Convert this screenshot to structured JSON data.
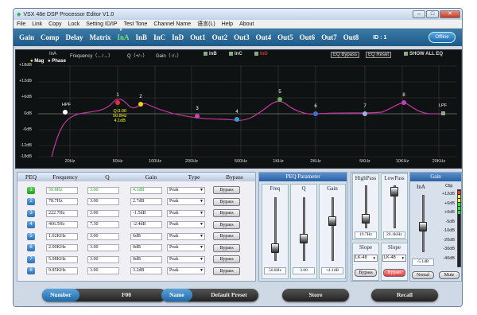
{
  "window": {
    "title": "VSX 48e DSP Processor Editor V1.0",
    "controls": [
      "–",
      "□",
      "✕"
    ]
  },
  "menu": [
    "File",
    "Link",
    "Copy",
    "Lock",
    "Setting ID/IP",
    "Test Tone",
    "Channel Name",
    "语言(L)",
    "Help",
    "About"
  ],
  "tabs": [
    "Gain",
    "Comp",
    "Delay",
    "Matrix",
    "InA",
    "InB",
    "InC",
    "InD",
    "Out1",
    "Out2",
    "Out3",
    "Out4",
    "Out5",
    "Out6",
    "Out7",
    "Out8"
  ],
  "active_tab": "InA",
  "device_id": "ID : 1",
  "offline_label": "Offline",
  "graph": {
    "channel": "InA",
    "freq_hint": "Frequency（←/→）",
    "q_hint": "Q（+/−）",
    "gain_hint": "Gain（↑/↓）",
    "show_channels": [
      "InB",
      "InC",
      "InD"
    ],
    "eq_bypass": "EQ Bypass",
    "eq_reset": "EQ Reset",
    "show_all_eq": "SHOW ALL EQ",
    "legend_mag": "Mag",
    "legend_phase": "Phase",
    "y_labels": [
      "+18dB",
      "+12dB",
      "+6dB",
      "0dB",
      "-6dB",
      "-12dB",
      "-18dB"
    ],
    "x_labels": [
      "20Hz",
      "50Hz",
      "100Hz",
      "200Hz",
      "500Hz",
      "1KHz",
      "2KHz",
      "5KHz",
      "10KHz",
      "20KHz"
    ],
    "hpf_label": "HPF",
    "lpf_label": "LPF",
    "points": [
      "1",
      "2",
      "3",
      "4",
      "5",
      "6",
      "7",
      "8"
    ],
    "selected_info": [
      "Q:3.00",
      "50.8Hz",
      "4.1dB"
    ]
  },
  "peq_table": {
    "headers": [
      "PEQ",
      "Frequency",
      "Q",
      "Gain",
      "Type",
      "Bypass"
    ],
    "rows": [
      {
        "n": "1",
        "freq": "50.8Hz",
        "q": "3.00",
        "gain": "4.1dB",
        "type": "Peak",
        "bypass": "Bypass"
      },
      {
        "n": "2",
        "freq": "78.7Hz",
        "q": "3.00",
        "gain": "2.7dB",
        "type": "Peak",
        "bypass": "Bypass"
      },
      {
        "n": "3",
        "freq": "222.7Hz",
        "q": "3.00",
        "gain": "-1.5dB",
        "type": "Peak",
        "bypass": "Bypass"
      },
      {
        "n": "4",
        "freq": "466.5Hz",
        "q": "7.30",
        "gain": "-2.4dB",
        "type": "Peak",
        "bypass": "Bypass"
      },
      {
        "n": "5",
        "freq": "1.02KHz",
        "q": "3.00",
        "gain": "6dB",
        "type": "Peak",
        "bypass": "Bypass"
      },
      {
        "n": "6",
        "freq": "2.00KHz",
        "q": "3.00",
        "gain": "0dB",
        "type": "Peak",
        "bypass": "Bypass"
      },
      {
        "n": "7",
        "freq": "5.08KHz",
        "q": "3.00",
        "gain": "0dB",
        "type": "Peak",
        "bypass": "Bypass"
      },
      {
        "n": "8",
        "freq": "9.85KHz",
        "q": "3.00",
        "gain": "3.2dB",
        "type": "Peak",
        "bypass": "Bypass"
      }
    ]
  },
  "peq_param": {
    "title": "PEQ Parameter",
    "freq_label": "Freq",
    "q_label": "Q",
    "gain_label": "Gain",
    "freq_value": "50.8Hz",
    "q_value": "3.00",
    "gain_value": "+4.1dB"
  },
  "highpass": {
    "title": "HighPass",
    "value": "19.7Hz",
    "slope_label": "Slope",
    "slope": "LK-48",
    "bypass": "Bypass"
  },
  "lowpass": {
    "title": "LowPass",
    "value": "20.1KHz",
    "slope_label": "Slope",
    "slope": "LK-48",
    "bypass": "Bypass"
  },
  "gain_panel": {
    "title": "Gain",
    "channel": "InA",
    "value": "-5.1dB",
    "normal": "Nomal",
    "mute": "Mute",
    "clip": "Clip",
    "scale": [
      "+12dB",
      "+6dB",
      "+0dB",
      "-5dB",
      "-10dB",
      "-20dB",
      "-30dB",
      "-40dB"
    ]
  },
  "bottom": {
    "number_label": "Number",
    "number_value": "F00",
    "name_label": "Name",
    "name_value": "Default Preset",
    "store": "Store",
    "recall": "Recall"
  }
}
